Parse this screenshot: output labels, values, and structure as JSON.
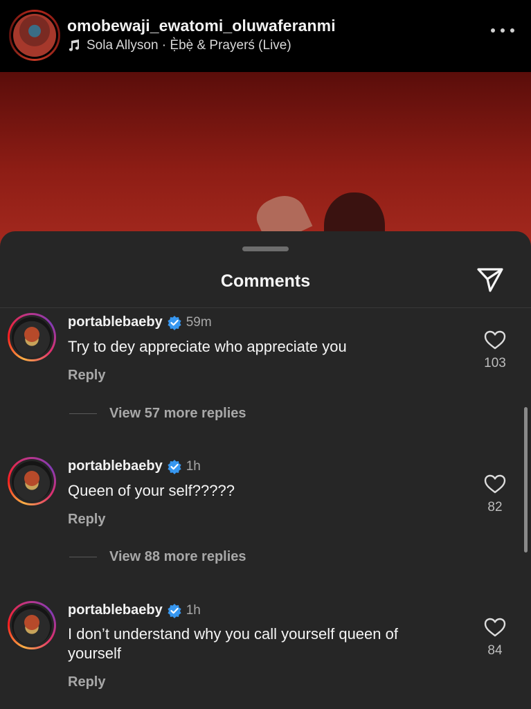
{
  "post": {
    "username": "omobewaji_ewatomi_oluwaferanmi",
    "music": "Sola Allyson · Ẹ̀bẹ̀ & Prayerś (Live)"
  },
  "comments_sheet": {
    "title": "Comments",
    "comments": [
      {
        "username": "portablebaeby",
        "time": "59m",
        "text": "Try to dey appreciate who appreciate you",
        "reply_label": "Reply",
        "likes": "103",
        "view_replies": "View 57 more replies"
      },
      {
        "username": "portablebaeby",
        "time": "1h",
        "text": "Queen of your self?????",
        "reply_label": "Reply",
        "likes": "82",
        "view_replies": "View 88 more replies"
      },
      {
        "username": "portablebaeby",
        "time": "1h",
        "text": "I don’t understand why you call yourself queen of yourself",
        "reply_label": "Reply",
        "likes": "84"
      }
    ]
  },
  "icons": {
    "music": "music-note-icon",
    "more": "more-options-icon",
    "share": "send-icon",
    "verified": "verified-badge-icon",
    "like": "heart-icon"
  },
  "colors": {
    "sheet_bg": "#262626",
    "verified_blue": "#3797f0",
    "video_red": "#8e1d15"
  }
}
